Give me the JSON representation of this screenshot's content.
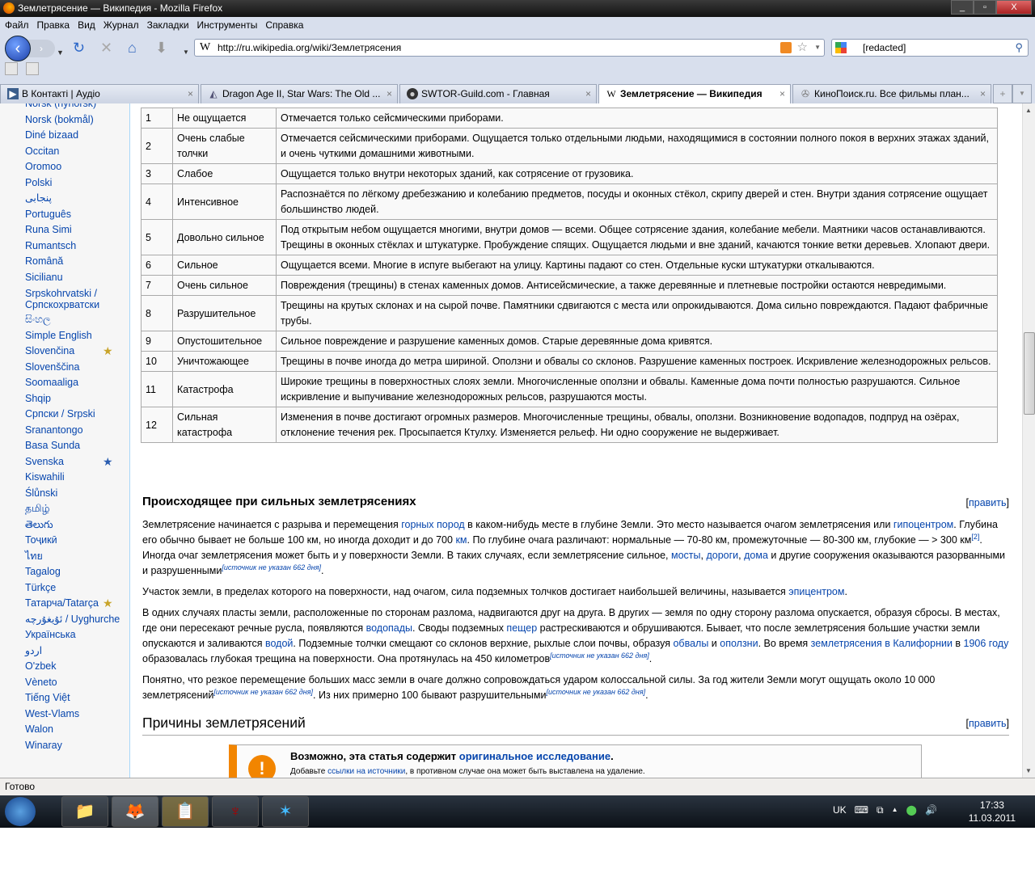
{
  "window": {
    "title": "Землетрясение — Википедия - Mozilla Firefox",
    "controls": [
      "minimize",
      "maximize",
      "close"
    ]
  },
  "menu": [
    "Файл",
    "Правка",
    "Вид",
    "Журнал",
    "Закладки",
    "Инструменты",
    "Справка"
  ],
  "toolbar": {
    "url": "http://ru.wikipedia.org/wiki/Землетрясения",
    "search_value": "[redacted]"
  },
  "tabs": [
    {
      "label": "В Контакті | Аудіо",
      "icon": "vk-icon"
    },
    {
      "label": "Dragon Age II, Star Wars: The Old ...",
      "icon": "dragon-icon"
    },
    {
      "label": "SWTOR-Guild.com - Главная",
      "icon": "swtor-icon"
    },
    {
      "label": "Землетрясение — Википедия",
      "icon": "wikipedia-icon",
      "active": true
    },
    {
      "label": "КиноПоиск.ru. Все фильмы план...",
      "icon": "film-icon"
    }
  ],
  "sidebar": {
    "languages": [
      {
        "label": "Norsk (nynorsk)"
      },
      {
        "label": "Norsk (bokmål)"
      },
      {
        "label": "Diné bizaad"
      },
      {
        "label": "Occitan"
      },
      {
        "label": "Oromoo"
      },
      {
        "label": "Polski"
      },
      {
        "label": "پنجابی"
      },
      {
        "label": "Português"
      },
      {
        "label": "Runa Simi"
      },
      {
        "label": "Rumantsch"
      },
      {
        "label": "Română"
      },
      {
        "label": "Sicilianu"
      },
      {
        "label": "Srpskohrvatski / Српскохрватски",
        "two": true
      },
      {
        "label": "සිංහල"
      },
      {
        "label": "Simple English"
      },
      {
        "label": "Slovenčina",
        "badge": "gold"
      },
      {
        "label": "Slovenščina"
      },
      {
        "label": "Soomaaliga"
      },
      {
        "label": "Shqip"
      },
      {
        "label": "Српски / Srpski"
      },
      {
        "label": "Sranantongo"
      },
      {
        "label": "Basa Sunda"
      },
      {
        "label": "Svenska",
        "badge": "blue"
      },
      {
        "label": "Kiswahili"
      },
      {
        "label": "Ślůnski"
      },
      {
        "label": "தமிழ்"
      },
      {
        "label": "తెలుగు"
      },
      {
        "label": "Тоҷикӣ"
      },
      {
        "label": "ไทย"
      },
      {
        "label": "Tagalog"
      },
      {
        "label": "Türkçe"
      },
      {
        "label": "Татарча/Tatarça",
        "badge": "gold"
      },
      {
        "label": "ئۇيغۇرچە / Uyghurche"
      },
      {
        "label": "Українська"
      },
      {
        "label": "اردو"
      },
      {
        "label": "O'zbek"
      },
      {
        "label": "Vèneto"
      },
      {
        "label": "Tiếng Việt"
      },
      {
        "label": "West-Vlams"
      },
      {
        "label": "Walon"
      },
      {
        "label": "Winaray"
      }
    ]
  },
  "table": {
    "rows": [
      [
        "1",
        "Не ощущается",
        "Отмечается только сейсмическими приборами."
      ],
      [
        "2",
        "Очень слабые толчки",
        "Отмечается сейсмическими приборами. Ощущается только отдельными людьми, находящимися в состоянии полного покоя в верхних этажах зданий, и очень чуткими домашними животными."
      ],
      [
        "3",
        "Слабое",
        "Ощущается только внутри некоторых зданий, как сотрясение от грузовика."
      ],
      [
        "4",
        "Интенсивное",
        "Распознаётся по лёгкому дребезжанию и колебанию предметов, посуды и оконных стёкол, скрипу дверей и стен. Внутри здания сотрясение ощущает большинство людей."
      ],
      [
        "5",
        "Довольно сильное",
        "Под открытым небом ощущается многими, внутри домов — всеми. Общее сотрясение здания, колебание мебели. Маятники часов останавливаются. Трещины в оконных стёклах и штукатурке. Пробуждение спящих. Ощущается людьми и вне зданий, качаются тонкие ветки деревьев. Хлопают двери."
      ],
      [
        "6",
        "Сильное",
        "Ощущается всеми. Многие в испуге выбегают на улицу. Картины падают со стен. Отдельные куски штукатурки откалываются."
      ],
      [
        "7",
        "Очень сильное",
        "Повреждения (трещины) в стенах каменных домов. Антисейсмические, а также деревянные и плетневые постройки остаются невредимыми."
      ],
      [
        "8",
        "Разрушительное",
        "Трещины на крутых склонах и на сырой почве. Памятники сдвигаются с места или опрокидываются. Дома сильно повреждаются. Падают фабричные трубы."
      ],
      [
        "9",
        "Опустошительное",
        "Сильное повреждение и разрушение каменных домов. Старые деревянные дома кривятся."
      ],
      [
        "10",
        "Уничтожающее",
        "Трещины в почве иногда до метра шириной. Оползни и обвалы со склонов. Разрушение каменных построек. Искривление железнодорожных рельсов."
      ],
      [
        "11",
        "Катастрофа",
        "Широкие трещины в поверхностных слоях земли. Многочисленные оползни и обвалы. Каменные дома почти полностью разрушаются. Сильное искривление и выпучивание железнодорожных рельсов, разрушаются мосты."
      ],
      [
        "12",
        "Сильная катастрофа",
        "Изменения в почве достигают огромных размеров. Многочисленные трещины, обвалы, оползни. Возникновение водопадов, подпруд на озёрах, отклонение течения рек. Просыпается Ктулху. Изменяется рельеф. Ни одно сооружение не выдерживает."
      ]
    ]
  },
  "section1": {
    "title": "Происходящее при сильных землетрясениях",
    "edit": "править",
    "p1": [
      "Землетрясение начинается с разрыва и перемещения ",
      "горных пород",
      " в каком-нибудь месте в глубине Земли. Это место называется очагом землетрясения или ",
      "гипоцентром",
      ". Глубина его обычно бывает не больше 100 км, но иногда доходит и до 700 ",
      "км",
      ". По глубине очага различают: нормальные — 70-80 км, промежуточные — 80-300 км, глубокие — > 300 км",
      "[2]",
      ". Иногда очаг землетрясения может быть и у поверхности Земли. В таких случаях, если землетрясение сильное, ",
      "мосты",
      ", ",
      "дороги",
      ", ",
      "дома",
      " и другие сооружения оказываются разорванными и разрушенными",
      "[источник не указан 662 дня]",
      "."
    ],
    "p2": [
      "Участок земли, в пределах которого на поверхности, над очагом, сила подземных толчков достигает наибольшей величины, называется ",
      "эпицентром",
      "."
    ],
    "p3": [
      "В одних случаях пласты земли, расположенные по сторонам разлома, надвигаются друг на друга. В других — земля по одну сторону разлома опускается, образуя сбросы. В местах, где они пересекают речные русла, появляются ",
      "водопады",
      ". Своды подземных ",
      "пещер",
      " растрескиваются и обрушиваются. Бывает, что после землетрясения большие участки земли опускаются и заливаются ",
      "водой",
      ". Подземные толчки смещают со склонов верхние, рыхлые слои почвы, образуя ",
      "обвалы",
      " и ",
      "оползни",
      ". Во время ",
      "землетрясения в Калифорнии",
      " в ",
      "1906 году",
      " образовалась глубокая трещина на поверхности. Она протянулась на 450 километров",
      "[источник не указан 662 дня]",
      "."
    ],
    "p4": [
      "Понятно, что резкое перемещение больших масс земли в очаге должно сопровождаться ударом колоссальной силы. За год жители Земли могут ощущать около 10 000 землетрясений",
      "[источник не указан 662 дня]",
      ". Из них примерно 100 бывают разрушительными",
      "[источник не указан 662 дня]",
      "."
    ]
  },
  "section2": {
    "title": "Причины землетрясений",
    "edit": "править"
  },
  "ambox": {
    "t1a": "Возможно, эта статья содержит ",
    "t1link": "оригинальное исследование",
    "t1b": ".",
    "t2a": "Добавьте ",
    "t2link": "ссылки на источники",
    "t2b": ", в противном случае она может быть выставлена на удаление."
  },
  "status": "Готово",
  "taskbar": {
    "lang": "UK",
    "time": "17:33",
    "date": "11.03.2011"
  },
  "colors": {
    "link": "#0645ad",
    "ambox_accent": "#f28500"
  }
}
